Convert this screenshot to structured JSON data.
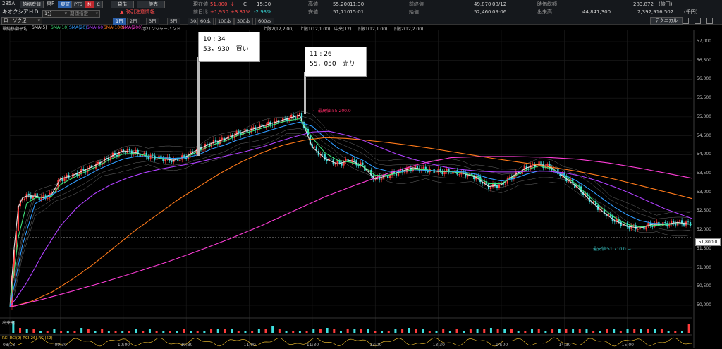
{
  "header": {
    "code": "285A",
    "name": "キオクシアＨＤ",
    "chart_style": "ローソク足",
    "watch_button": "銘柄登録",
    "exchange": "東P",
    "btn_tosho": "東証",
    "btn_pts": "PTS",
    "btn_n": "N",
    "btn_c": "C",
    "margin_buy": "貸借",
    "general": "一般売",
    "alert": "▲ 取引注意情報",
    "interval": "1分",
    "period_placeholder": "期間指定",
    "current_label": "現在値",
    "current_value": "51,800",
    "current_mark": "↓",
    "current_c": "C",
    "current_time": "15:30",
    "change_label": "前日比",
    "change_value": "+1,930",
    "change_pct": "+3.87%",
    "change_pct2": "-2.93%",
    "high_label": "高値",
    "high_value": "55,200",
    "high_time": "11:30",
    "low_label": "安値",
    "low_value": "51,710",
    "low_time": "15:01",
    "prevclose_label": "前終値",
    "prevclose_value": "49,870",
    "prevclose_date": "08/12",
    "open_label": "始値",
    "open_value": "52,460",
    "open_time": "09:06",
    "volume_label": "出来高",
    "volume_value": "44,841,300",
    "mcap_label": "時価総額",
    "mcap_value": "283,872",
    "mcap_unit": "(億円)",
    "turnover_value": "2,392,916,502",
    "turnover_unit": "(千円)",
    "technical_button": "テクニカル",
    "timeframes": [
      "1日",
      "2日",
      "3日",
      "5日",
      "30本",
      "60本",
      "100本",
      "300本",
      "600本"
    ],
    "timeframe_selected": "1日"
  },
  "indicators": {
    "row1": [
      "單純移動平均",
      "SMA(5)",
      "SMA(10)",
      "SMA(20)",
      "SMA(60)",
      "SMA(100)",
      "SMA(200)",
      "ボリンジャーバンド"
    ],
    "row1_colors": [
      "#cfcfcf",
      "#e0e0e0",
      "#3ee37a",
      "#2f9bff",
      "#b040ff",
      "#ff7a1a",
      "#ff3dd8",
      "#cfcfcf"
    ],
    "row2": [
      "上限2(12,2.00)",
      "上限1(12,1.00)",
      "中央(12)",
      "下限1(12,1.00)",
      "下限2(12,2.00)"
    ]
  },
  "notes": [
    {
      "time": "10 : 34",
      "text": "53，930　買い"
    },
    {
      "time": "11 : 26",
      "text": "55，050　売り"
    }
  ],
  "markers": {
    "high": "← 最高値:55,200.0",
    "low": "最安値:51,710.0 →",
    "last_price": "51,800.0"
  },
  "volume_label": "出来高",
  "bottom_indicator": "RCI RCI(9) RCI(26) RCI(52)",
  "chart_data": {
    "type": "line",
    "title": "",
    "xlabel": "",
    "ylabel": "",
    "ylim": [
      49700,
      57300
    ],
    "y_ticks": [
      50000,
      50500,
      51000,
      51500,
      52000,
      52500,
      53000,
      53500,
      54000,
      54500,
      55000,
      55500,
      56000,
      56500,
      57000
    ],
    "x_tick_labels": [
      "08/13",
      "09:30",
      "10:00",
      "10:30",
      "11:00",
      "11:30",
      "13:00",
      "13:30",
      "14:00",
      "14:30",
      "15:00"
    ],
    "x_tick_positions": [
      0,
      24,
      54,
      84,
      114,
      144,
      174,
      204,
      234,
      264,
      294
    ],
    "x_range": [
      0,
      325
    ],
    "series": [
      {
        "name": "SMA(5)",
        "color": "#e0e0e0",
        "x": [
          0,
          2,
          4,
          6,
          8,
          12,
          16,
          20,
          24,
          30,
          36,
          42,
          48,
          54,
          60,
          66,
          72,
          78,
          84,
          90,
          96,
          102,
          108,
          114,
          120,
          126,
          132,
          138,
          144,
          150,
          156,
          162,
          168,
          174,
          180,
          186,
          192,
          198,
          204,
          210,
          216,
          222,
          228,
          234,
          240,
          246,
          252,
          258,
          264,
          270,
          276,
          282,
          288,
          294,
          300,
          306,
          312,
          318,
          325
        ],
        "y": [
          49950,
          51500,
          52600,
          52850,
          52900,
          52900,
          52850,
          52950,
          53350,
          53450,
          53600,
          53750,
          53950,
          54100,
          54050,
          53950,
          53900,
          53850,
          53950,
          54150,
          54300,
          54400,
          54550,
          54650,
          54750,
          54850,
          54950,
          55050,
          54200,
          53900,
          53750,
          53850,
          53700,
          53350,
          53450,
          53550,
          53650,
          53600,
          53550,
          53550,
          53500,
          53400,
          53150,
          53200,
          53450,
          53650,
          53750,
          53650,
          53400,
          53150,
          52800,
          52500,
          52250,
          52100,
          52050,
          52150,
          52150,
          52200,
          52150
        ]
      },
      {
        "name": "SMA(10)",
        "color": "#3ee37a",
        "x": [
          0,
          4,
          8,
          12,
          16,
          20,
          24,
          30,
          36,
          42,
          48,
          54,
          60,
          66,
          72,
          78,
          84,
          90,
          96,
          102,
          108,
          114,
          120,
          126,
          132,
          138,
          144,
          150,
          156,
          162,
          168,
          174,
          180,
          186,
          192,
          198,
          204,
          210,
          216,
          222,
          228,
          234,
          240,
          246,
          252,
          258,
          264,
          270,
          276,
          282,
          288,
          294,
          300,
          306,
          312,
          318,
          325
        ],
        "y": [
          49950,
          51800,
          52700,
          52850,
          52870,
          52900,
          53200,
          53380,
          53550,
          53700,
          53880,
          54020,
          54030,
          53960,
          53900,
          53880,
          53930,
          54100,
          54250,
          54350,
          54500,
          54600,
          54700,
          54800,
          54900,
          54950,
          54450,
          54050,
          53850,
          53800,
          53700,
          53450,
          53450,
          53530,
          53610,
          53600,
          53560,
          53550,
          53510,
          53430,
          53230,
          53230,
          53420,
          53600,
          53700,
          53630,
          53440,
          53200,
          52880,
          52580,
          52330,
          52150,
          52080,
          52120,
          52140,
          52170,
          52150
        ]
      },
      {
        "name": "SMA(20)",
        "color": "#2f9bff",
        "x": [
          0,
          6,
          12,
          18,
          24,
          30,
          36,
          42,
          48,
          54,
          60,
          66,
          72,
          78,
          84,
          90,
          96,
          102,
          108,
          114,
          120,
          126,
          132,
          138,
          144,
          150,
          156,
          162,
          168,
          174,
          180,
          186,
          192,
          198,
          204,
          210,
          216,
          222,
          228,
          234,
          240,
          246,
          252,
          258,
          264,
          270,
          276,
          282,
          288,
          294,
          300,
          306,
          312,
          318,
          325
        ],
        "y": [
          49950,
          51600,
          52700,
          52880,
          53050,
          53250,
          53420,
          53600,
          53750,
          53880,
          53950,
          53950,
          53920,
          53900,
          53920,
          54000,
          54150,
          54250,
          54380,
          54480,
          54580,
          54680,
          54780,
          54860,
          54750,
          54450,
          54180,
          54000,
          53850,
          53650,
          53560,
          53550,
          53570,
          53580,
          53570,
          53560,
          53540,
          53480,
          53370,
          53300,
          53360,
          53480,
          53570,
          53560,
          53460,
          53300,
          53080,
          52840,
          52600,
          52400,
          52250,
          52180,
          52160,
          52160,
          52160
        ]
      },
      {
        "name": "SMA(60)",
        "color": "#b040ff",
        "x": [
          0,
          8,
          16,
          24,
          32,
          40,
          48,
          56,
          64,
          72,
          80,
          88,
          96,
          104,
          112,
          120,
          128,
          136,
          144,
          152,
          160,
          168,
          176,
          184,
          192,
          200,
          208,
          216,
          224,
          232,
          240,
          248,
          256,
          264,
          272,
          280,
          288,
          296,
          304,
          312,
          318,
          325
        ],
        "y": [
          49950,
          50600,
          51400,
          52100,
          52600,
          52950,
          53200,
          53380,
          53520,
          53620,
          53700,
          53780,
          53880,
          53980,
          54080,
          54200,
          54350,
          54480,
          54600,
          54620,
          54520,
          54380,
          54200,
          54020,
          53880,
          53760,
          53660,
          53600,
          53560,
          53540,
          53540,
          53560,
          53560,
          53520,
          53430,
          53300,
          53140,
          52960,
          52760,
          52560,
          52440,
          52300
        ]
      },
      {
        "name": "SMA(100)",
        "color": "#ff7a1a",
        "x": [
          0,
          10,
          20,
          30,
          40,
          50,
          60,
          70,
          80,
          90,
          100,
          110,
          120,
          130,
          140,
          150,
          160,
          170,
          180,
          190,
          200,
          210,
          220,
          230,
          240,
          250,
          260,
          270,
          280,
          290,
          300,
          310,
          318,
          325
        ],
        "y": [
          49950,
          50100,
          50350,
          50700,
          51100,
          51550,
          52000,
          52400,
          52800,
          53150,
          53500,
          53800,
          54050,
          54250,
          54380,
          54450,
          54430,
          54380,
          54320,
          54250,
          54170,
          54080,
          53990,
          53900,
          53820,
          53740,
          53650,
          53560,
          53450,
          53320,
          53180,
          53040,
          52930,
          52830
        ]
      },
      {
        "name": "SMA(200)",
        "color": "#ff3dd8",
        "x": [
          0,
          15,
          30,
          45,
          60,
          75,
          90,
          105,
          120,
          135,
          150,
          165,
          180,
          195,
          210,
          225,
          240,
          255,
          270,
          285,
          300,
          315,
          325
        ],
        "y": [
          49950,
          50150,
          50380,
          50620,
          50880,
          51150,
          51450,
          51770,
          52120,
          52500,
          52880,
          53200,
          53500,
          53750,
          53920,
          53950,
          53950,
          53930,
          53880,
          53780,
          53640,
          53480,
          53370
        ]
      }
    ],
    "volume_bars": [
      9,
      4,
      3,
      3,
      2,
      2,
      3,
      2,
      2,
      2,
      4,
      3,
      2,
      3,
      2,
      2,
      2,
      2,
      3,
      2,
      3,
      2,
      2,
      2,
      2,
      3,
      2,
      2,
      2,
      3,
      3,
      3,
      3,
      2,
      2,
      2,
      3,
      3,
      5,
      3,
      2,
      2,
      2,
      2,
      3,
      3,
      4,
      3,
      2,
      3,
      3,
      3,
      3,
      2,
      2,
      2,
      3,
      3,
      4,
      3,
      3,
      2,
      2,
      3,
      2,
      3,
      2,
      3,
      3,
      3,
      4,
      3,
      3,
      3,
      2,
      2,
      3,
      3,
      2,
      3,
      3,
      3,
      3,
      3,
      3,
      2,
      2,
      3,
      3,
      2,
      3,
      3,
      3,
      3,
      3,
      3,
      2,
      2,
      2,
      7
    ]
  }
}
